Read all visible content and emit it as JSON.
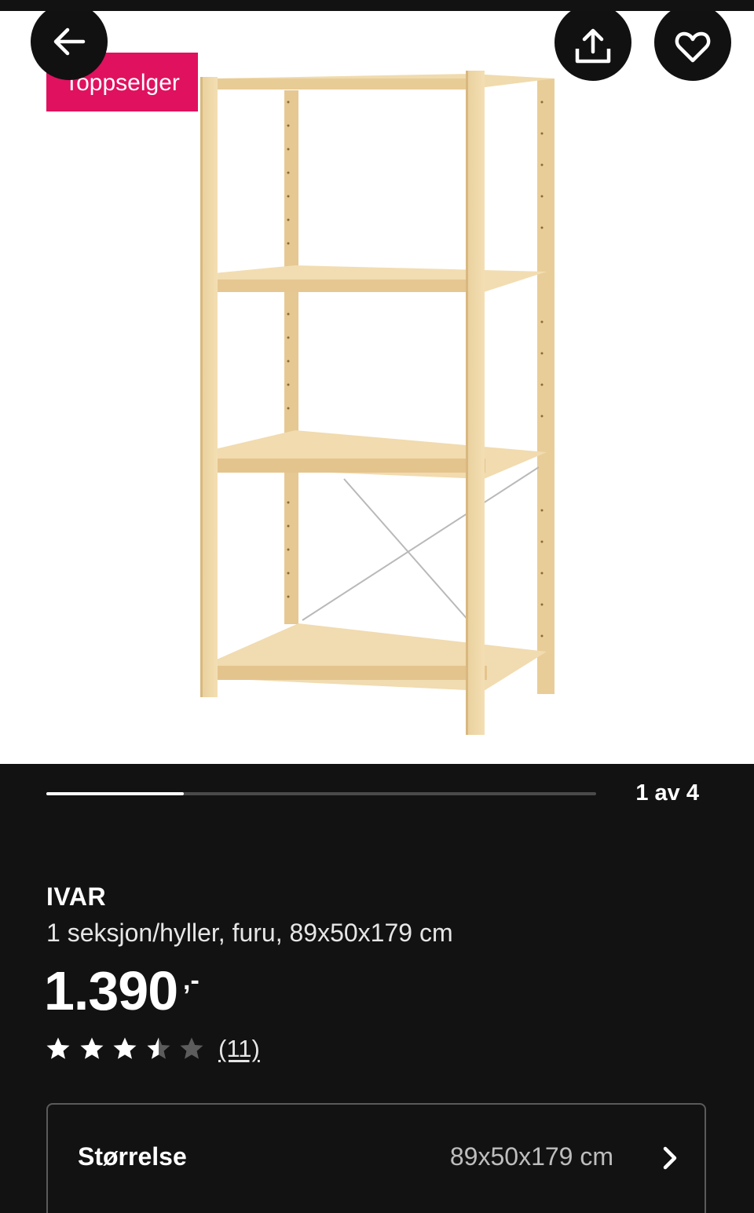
{
  "badge": {
    "label": "Toppselger"
  },
  "gallery": {
    "current": 1,
    "total": 4,
    "pager_text": "1 av 4",
    "progress_fraction": 0.25
  },
  "product": {
    "brand": "IVAR",
    "description": "1 seksjon/hyller, furu, 89x50x179 cm",
    "price": "1.390",
    "price_suffix": ",-",
    "rating": 3.5,
    "rating_max": 5,
    "review_count_text": "(11)"
  },
  "size": {
    "label": "Størrelse",
    "value": "89x50x179 cm"
  },
  "icons": {
    "back": "arrow-left-icon",
    "share": "share-upload-icon",
    "favorite": "heart-icon",
    "size_chevron": "chevron-right-icon"
  },
  "colors": {
    "badge": "#e0115f",
    "background": "#121212",
    "wood": "#ecd3a0"
  }
}
